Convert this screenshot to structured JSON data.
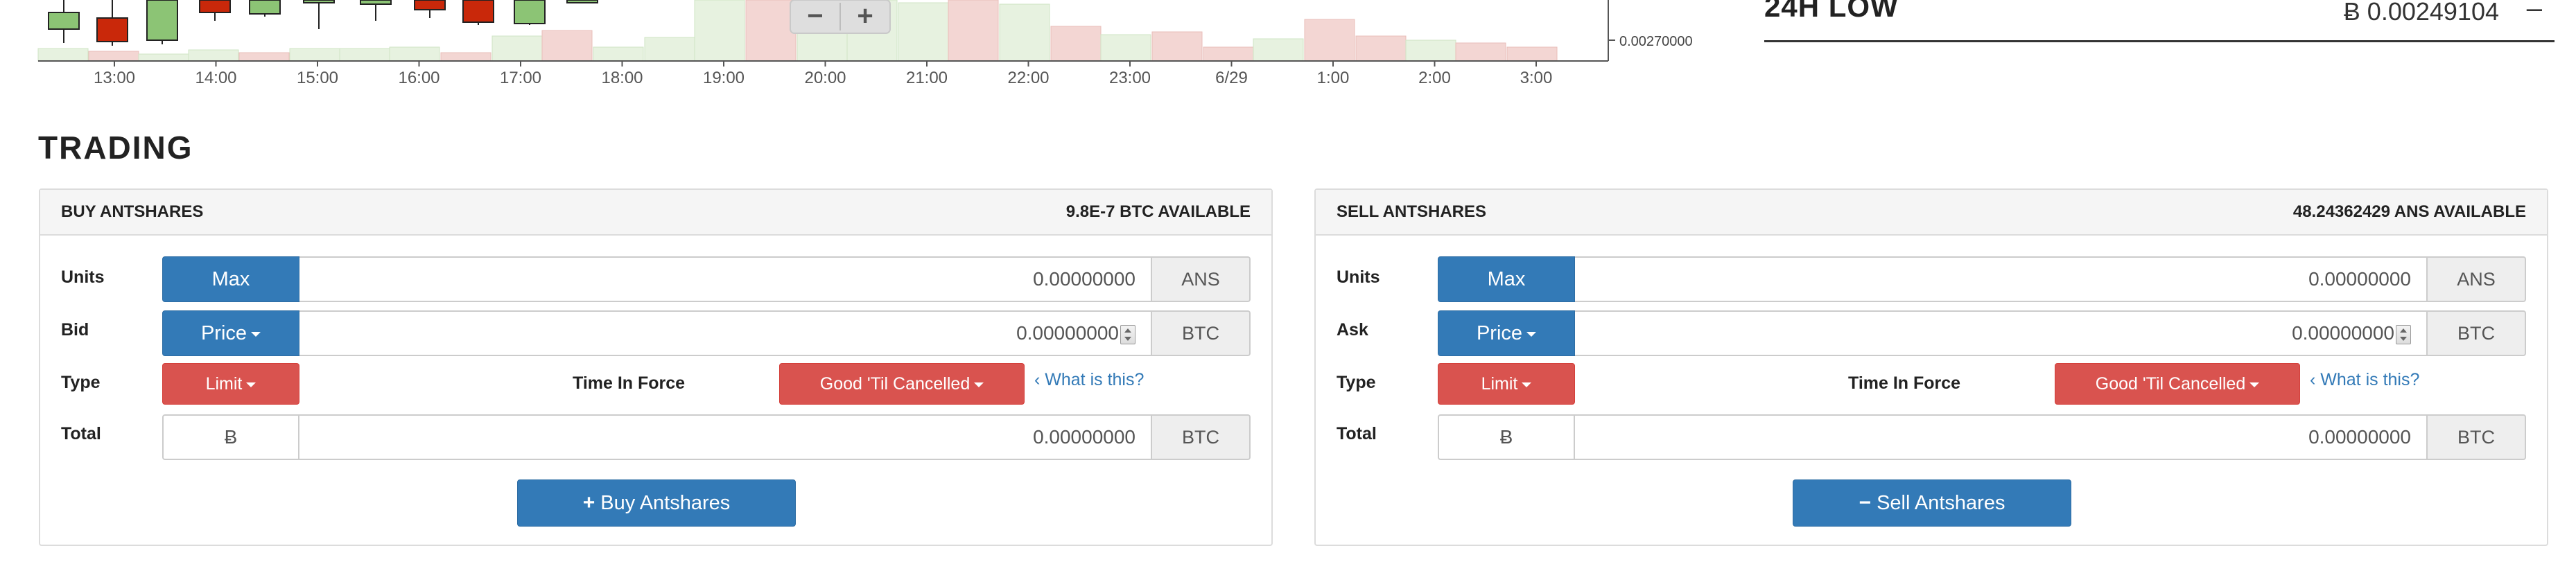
{
  "chart": {
    "time_labels": [
      "13:00",
      "14:00",
      "15:00",
      "16:00",
      "17:00",
      "18:00",
      "19:00",
      "20:00",
      "21:00",
      "22:00",
      "23:00",
      "6/29",
      "1:00",
      "2:00",
      "3:00"
    ],
    "price_label": "0.00270000",
    "zoom_out": "−",
    "zoom_in": "+",
    "colors": {
      "up": "#8cc475",
      "down": "#c9280a",
      "vol_up": "#e7f2e0",
      "vol_down": "#f3d6d3"
    }
  },
  "low24": {
    "label": "24H LOW",
    "value": "Ƀ 0.00249104",
    "toggle": "–"
  },
  "trading": {
    "title": "TRADING"
  },
  "buy": {
    "title": "BUY ANTSHARES",
    "available": "9.8E-7 BTC AVAILABLE",
    "units_label": "Units",
    "max_button": "Max",
    "units_value": "0.00000000",
    "units_currency": "ANS",
    "price_label": "Bid",
    "price_button": "Price",
    "price_value": "0.00000000",
    "price_currency": "BTC",
    "type_label": "Type",
    "type_button": "Limit",
    "tif_label": "Time In Force",
    "tif_button": "Good 'Til Cancelled",
    "what_link": "What is this?",
    "total_label": "Total",
    "total_symbol": "Ƀ",
    "total_value": "0.00000000",
    "total_currency": "BTC",
    "submit_glyph": "+",
    "submit_label": "Buy Antshares"
  },
  "sell": {
    "title": "SELL ANTSHARES",
    "available": "48.24362429 ANS AVAILABLE",
    "units_label": "Units",
    "max_button": "Max",
    "units_value": "0.00000000",
    "units_currency": "ANS",
    "price_label": "Ask",
    "price_button": "Price",
    "price_value": "0.00000000",
    "price_currency": "BTC",
    "type_label": "Type",
    "type_button": "Limit",
    "tif_label": "Time In Force",
    "tif_button": "Good 'Til Cancelled",
    "what_link": "What is this?",
    "total_label": "Total",
    "total_symbol": "Ƀ",
    "total_value": "0.00000000",
    "total_currency": "BTC",
    "submit_glyph": "−",
    "submit_label": "Sell Antshares"
  }
}
